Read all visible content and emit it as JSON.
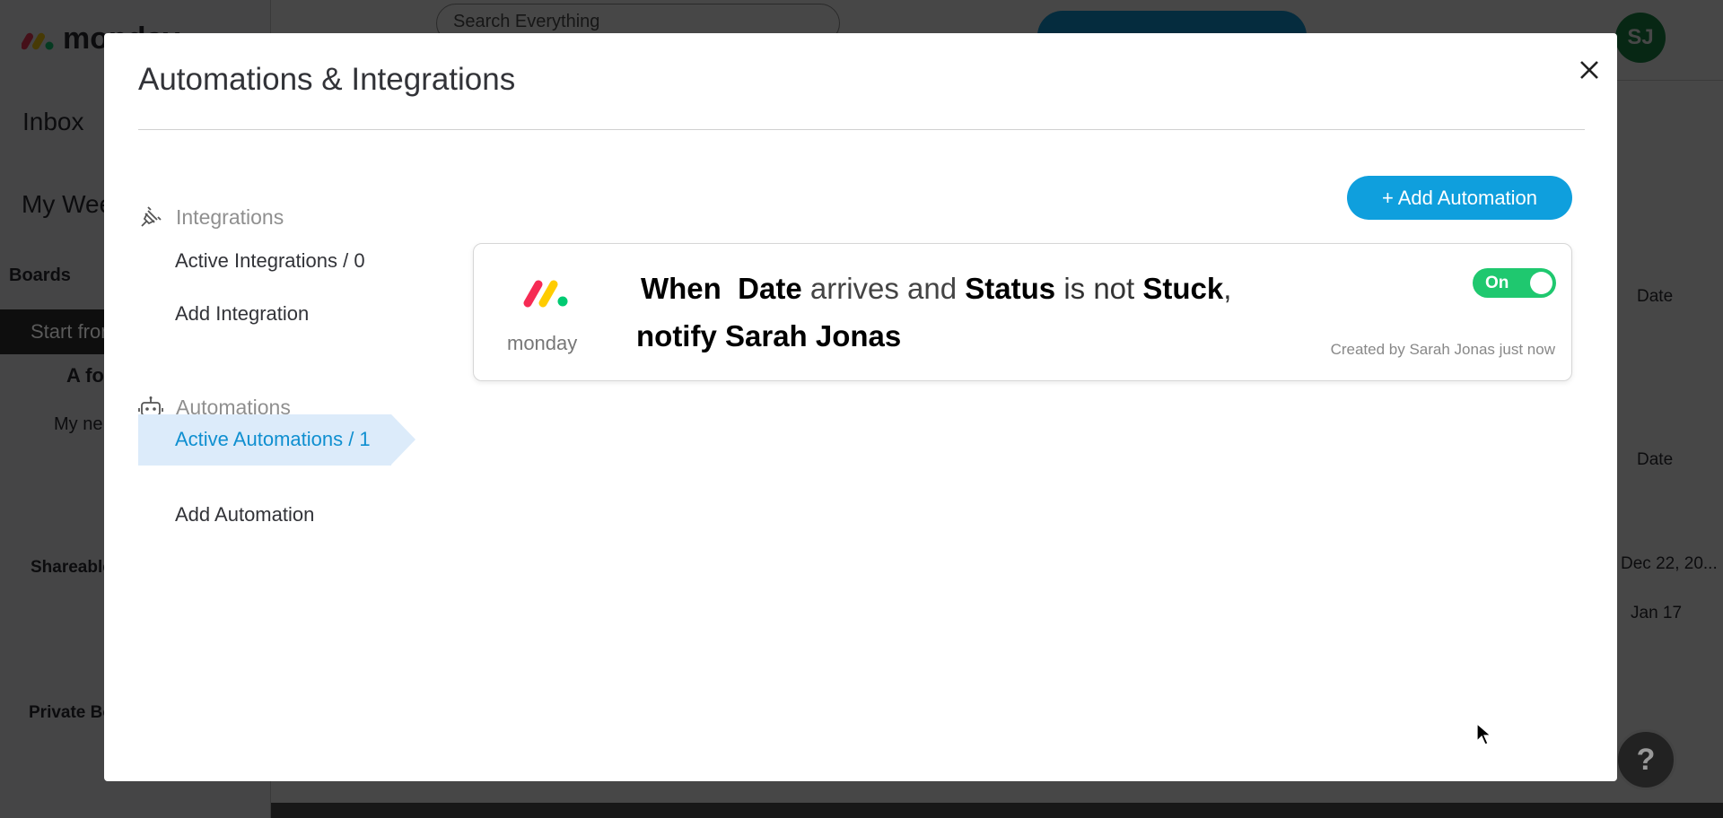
{
  "background": {
    "logo_text": "monday",
    "search_placeholder": "Search Everything",
    "avatar_initials": "SJ",
    "sidebar": {
      "inbox": "Inbox",
      "my_week": "My Week",
      "boards": "Boards",
      "start_from": "Start from",
      "folder": "A fol",
      "my_new": "My ne",
      "shareable": "Shareable",
      "private": "Private Bo"
    },
    "columns": [
      "Date",
      "Date"
    ],
    "dates": [
      "Dec 22, 20...",
      "Jan 17"
    ],
    "help": "?"
  },
  "modal": {
    "title": "Automations & Integrations",
    "close_icon": "close-icon",
    "nav": {
      "integrations_header": "Integrations",
      "active_integrations": "Active Integrations / 0",
      "add_integration": "Add Integration",
      "automations_header": "Automations",
      "active_automations": "Active Automations / 1",
      "add_automation": "Add Automation"
    },
    "add_button": "+ Add Automation",
    "automation": {
      "source": "monday",
      "when": "When",
      "date": "Date",
      "arrives_and": "arrives and",
      "status": "Status",
      "is_not": "is not",
      "stuck": "Stuck",
      "comma": ",",
      "action": "notify Sarah Jonas",
      "toggle_label": "On",
      "enabled": true,
      "created": "Created by Sarah Jonas just now"
    },
    "accent": "#0f9fdd",
    "toggle_color": "#1fc86f"
  }
}
